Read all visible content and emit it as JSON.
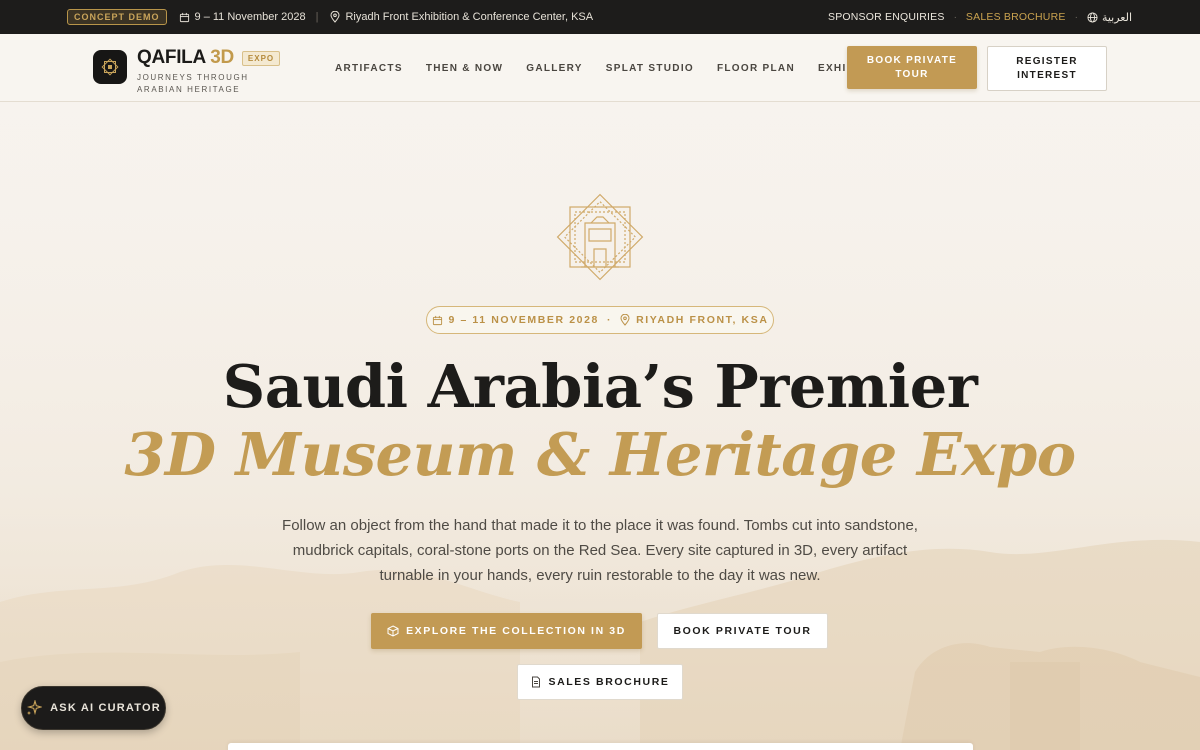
{
  "topbar": {
    "demo_badge": "CONCEPT DEMO",
    "date": "9 – 11 November 2028",
    "venue": "Riyadh Front Exhibition & Conference Center, KSA",
    "sponsor_link": "SPONSOR ENQUIRIES",
    "brochure_link": "SALES BROCHURE",
    "language": "العربية",
    "icons": [
      "calendar-icon",
      "location-pin-icon",
      "globe-icon"
    ]
  },
  "header": {
    "brand_name": "QAFILA",
    "brand_suffix": "3D",
    "brand_badge": "EXPO",
    "tagline": "JOURNEYS THROUGH ARABIAN HERITAGE",
    "nav": [
      "ARTIFACTS",
      "THEN & NOW",
      "GALLERY",
      "SPLAT STUDIO",
      "FLOOR PLAN",
      "EXHIBITORS"
    ],
    "book_button": "BOOK PRIVATE TOUR",
    "register_button": "REGISTER INTEREST"
  },
  "hero": {
    "pill_date": "9 – 11 NOVEMBER 2028",
    "pill_separator": "·",
    "pill_location": "RIYADH FRONT, KSA",
    "title_line1": "Saudi Arabia’s Premier",
    "title_line2": "3D Museum & Heritage Expo",
    "lead": "Follow an object from the hand that made it to the place it was found. Tombs cut into sandstone, mudbrick capitals, coral-stone ports on the Red Sea. Every site captured in 3D, every artifact turnable in your hands, every ruin restorable to the day it was new.",
    "explore_button": "EXPLORE THE COLLECTION IN 3D",
    "tour_button": "BOOK PRIVATE TOUR",
    "brochure_button": "SALES BROCHURE"
  },
  "assistant": {
    "label": "ASK AI CURATOR"
  },
  "colors": {
    "gold": "#c29a54",
    "dark": "#1d1c1b",
    "background": "#f6f2ec"
  }
}
